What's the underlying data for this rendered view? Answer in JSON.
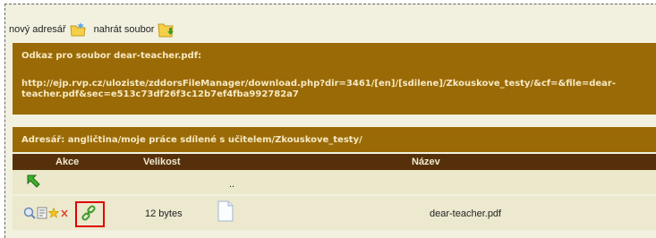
{
  "toolbar": {
    "new_folder_label": "nový adresář",
    "upload_label": "nahrát soubor"
  },
  "link_box": {
    "title": "Odkaz pro soubor dear-teacher.pdf:",
    "url_line1": "http://ejp.rvp.cz/uloziste/zddorsFileManager/download.php?dir=3461/[en]/[sdilene]/Zkouskove_testy/&cf=&file=dear-",
    "url_line2": "teacher.pdf&sec=e513c73df26f3c12b7ef4fba992782a7"
  },
  "folder_box": {
    "title": "Adresář: angličtina/moje práce sdílené s učitelem/Zkouskove_testy/"
  },
  "table": {
    "headers": {
      "actions": "Akce",
      "size": "Velikost",
      "name": "Název"
    },
    "parent_row": {
      "name": ".."
    },
    "file_row": {
      "size": "12 bytes",
      "name": "dear-teacher.pdf"
    }
  },
  "colors": {
    "panel_brown": "#9a6a06",
    "header_dark": "#55300a",
    "highlight": "#e00000"
  }
}
